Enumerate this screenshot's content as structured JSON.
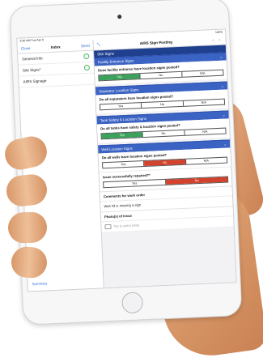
{
  "status_bar": {
    "time": "9:30 AM Tue Apr 9",
    "battery": "100%"
  },
  "left_pane": {
    "nav": {
      "close": "Close",
      "title": "Index",
      "send": "Send"
    },
    "items": [
      {
        "label": "General Info",
        "done": true
      },
      {
        "label": "Site Signs*",
        "done": true
      },
      {
        "label": "AIRS Signage",
        "done": false
      }
    ],
    "summary": "Summary"
  },
  "right_pane": {
    "nav": {
      "title": "AIRS Sign Posting",
      "prev": "<",
      "next": ">"
    },
    "page_header": "Site Signs",
    "sections": [
      {
        "title": "Facility Entrance Signs",
        "question": "Does facility entrance have location signs posted?",
        "options": [
          "Yes",
          "No",
          "N/A"
        ],
        "selected": "Yes"
      },
      {
        "title": "Separator Location Signs",
        "question": "Do all separators have location signs posted?",
        "options": [
          "Yes",
          "No",
          "N/A"
        ],
        "selected": ""
      },
      {
        "title": "Tank Safety & Location Signs",
        "question": "Do all tanks have safety & location signs posted?",
        "options": [
          "Yes",
          "No",
          "N/A"
        ],
        "selected": "Yes"
      },
      {
        "title": "Well Location Signs",
        "question": "Do all wells have location signs posted?",
        "options": [
          "Yes",
          "No",
          "N/A"
        ],
        "selected": "No"
      }
    ],
    "repair": {
      "question": "Issue successfully repaired?*",
      "options": [
        "Yes",
        "No"
      ],
      "selected": "No"
    },
    "comments": {
      "label": "Comments for work order",
      "value": "Well #3 is missing a sign"
    },
    "photos": {
      "label": "Photo(s) of Issue",
      "placeholder": "Tap to select photo"
    }
  }
}
